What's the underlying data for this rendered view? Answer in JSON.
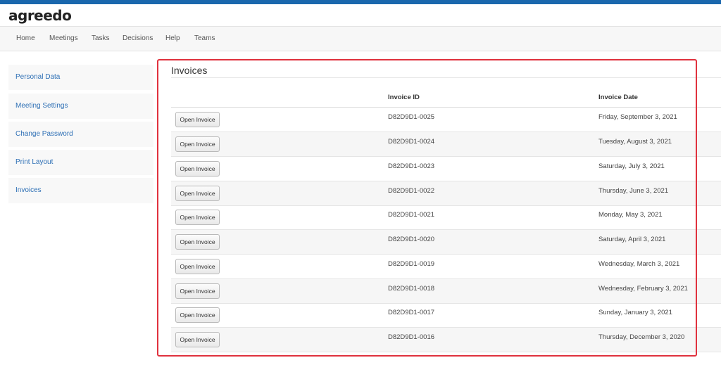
{
  "app": {
    "logo_text": "agreedo"
  },
  "nav": {
    "items": [
      {
        "label": "Home"
      },
      {
        "label": "Meetings"
      },
      {
        "label": "Tasks"
      },
      {
        "label": "Decisions"
      },
      {
        "label": "Help"
      },
      {
        "label": "Teams"
      }
    ]
  },
  "sidebar": {
    "items": [
      {
        "label": "Personal Data"
      },
      {
        "label": "Meeting Settings"
      },
      {
        "label": "Change Password"
      },
      {
        "label": "Print Layout"
      },
      {
        "label": "Invoices"
      }
    ]
  },
  "main": {
    "title": "Invoices",
    "columns": {
      "invoice_id": "Invoice ID",
      "invoice_date": "Invoice Date"
    },
    "open_label": "Open Invoice",
    "rows": [
      {
        "id": "D82D9D1-0025",
        "date": "Friday, September 3, 2021"
      },
      {
        "id": "D82D9D1-0024",
        "date": "Tuesday, August 3, 2021"
      },
      {
        "id": "D82D9D1-0023",
        "date": "Saturday, July 3, 2021"
      },
      {
        "id": "D82D9D1-0022",
        "date": "Thursday, June 3, 2021"
      },
      {
        "id": "D82D9D1-0021",
        "date": "Monday, May 3, 2021"
      },
      {
        "id": "D82D9D1-0020",
        "date": "Saturday, April 3, 2021"
      },
      {
        "id": "D82D9D1-0019",
        "date": "Wednesday, March 3, 2021"
      },
      {
        "id": "D82D9D1-0018",
        "date": "Wednesday, February 3, 2021"
      },
      {
        "id": "D82D9D1-0017",
        "date": "Sunday, January 3, 2021"
      },
      {
        "id": "D82D9D1-0016",
        "date": "Thursday, December 3, 2020"
      }
    ]
  },
  "colors": {
    "accent": "#1a67ad",
    "link": "#2d6fb5",
    "highlight": "#e0323e"
  }
}
